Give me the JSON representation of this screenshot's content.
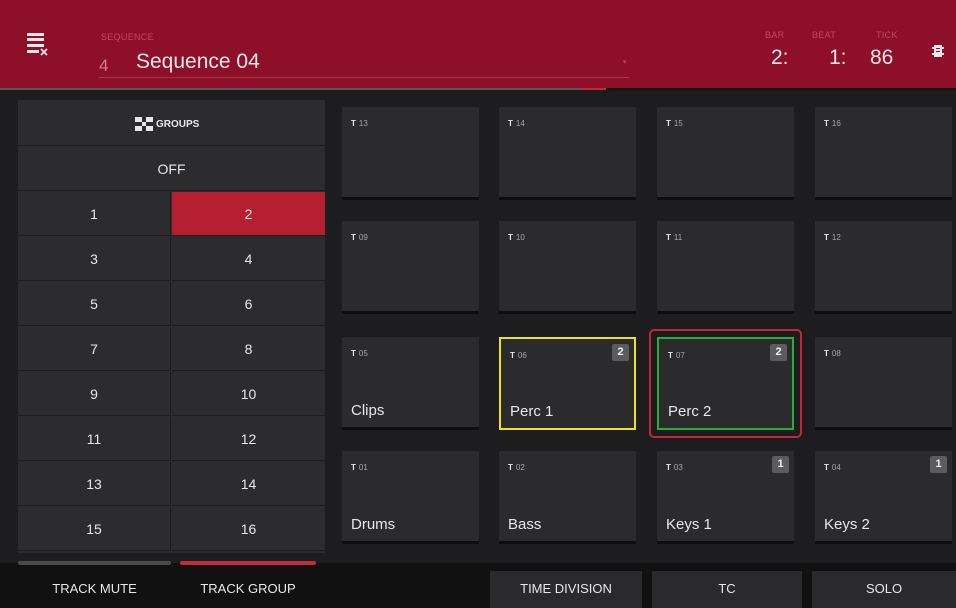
{
  "header": {
    "sequence_label": "SEQUENCE",
    "sequence_number": "4",
    "sequence_name": "Sequence 04",
    "dropdown_caret": "▾",
    "bar_label": "BAR",
    "bar_value": "2:",
    "beat_label": "BEAT",
    "beat_value": "1:",
    "tick_label": "TICK",
    "tick_value": "86",
    "left_icon": "sequence-edit-icon",
    "right_icon": "menu-icon"
  },
  "playhead": {
    "progress": 0.634
  },
  "groups": {
    "title": "GROUPS",
    "icon": "groups-icon",
    "off_label": "OFF",
    "cells": [
      "1",
      "2",
      "3",
      "4",
      "5",
      "6",
      "7",
      "8",
      "9",
      "10",
      "11",
      "12",
      "13",
      "14",
      "15",
      "16"
    ],
    "selected": "2"
  },
  "pads": [
    {
      "t": "T",
      "num": "13",
      "name": "",
      "badge": ""
    },
    {
      "t": "T",
      "num": "14",
      "name": "",
      "badge": ""
    },
    {
      "t": "T",
      "num": "15",
      "name": "",
      "badge": ""
    },
    {
      "t": "T",
      "num": "16",
      "name": "",
      "badge": ""
    },
    {
      "t": "T",
      "num": "09",
      "name": "",
      "badge": ""
    },
    {
      "t": "T",
      "num": "10",
      "name": "",
      "badge": ""
    },
    {
      "t": "T",
      "num": "11",
      "name": "",
      "badge": ""
    },
    {
      "t": "T",
      "num": "12",
      "name": "",
      "badge": ""
    },
    {
      "t": "T",
      "num": "05",
      "name": "Clips",
      "badge": ""
    },
    {
      "t": "T",
      "num": "06",
      "name": "Perc 1",
      "badge": "2"
    },
    {
      "t": "T",
      "num": "07",
      "name": "Perc 2",
      "badge": "2"
    },
    {
      "t": "T",
      "num": "08",
      "name": "",
      "badge": ""
    },
    {
      "t": "T",
      "num": "01",
      "name": "Drums",
      "badge": ""
    },
    {
      "t": "T",
      "num": "02",
      "name": "Bass",
      "badge": ""
    },
    {
      "t": "T",
      "num": "03",
      "name": "Keys 1",
      "badge": "1"
    },
    {
      "t": "T",
      "num": "04",
      "name": "Keys 2",
      "badge": "1"
    }
  ],
  "bottom": {
    "track_mute": "TRACK MUTE",
    "track_group": "TRACK GROUP",
    "time_division": "TIME DIVISION",
    "tc": "TC",
    "solo": "SOLO"
  },
  "colors": {
    "header_bg": "#8e0f2a",
    "active_group": "#b51f2f",
    "yellow_select": "#f0e21a",
    "green_select": "#27ae3a",
    "focus_red": "#c2263a"
  }
}
